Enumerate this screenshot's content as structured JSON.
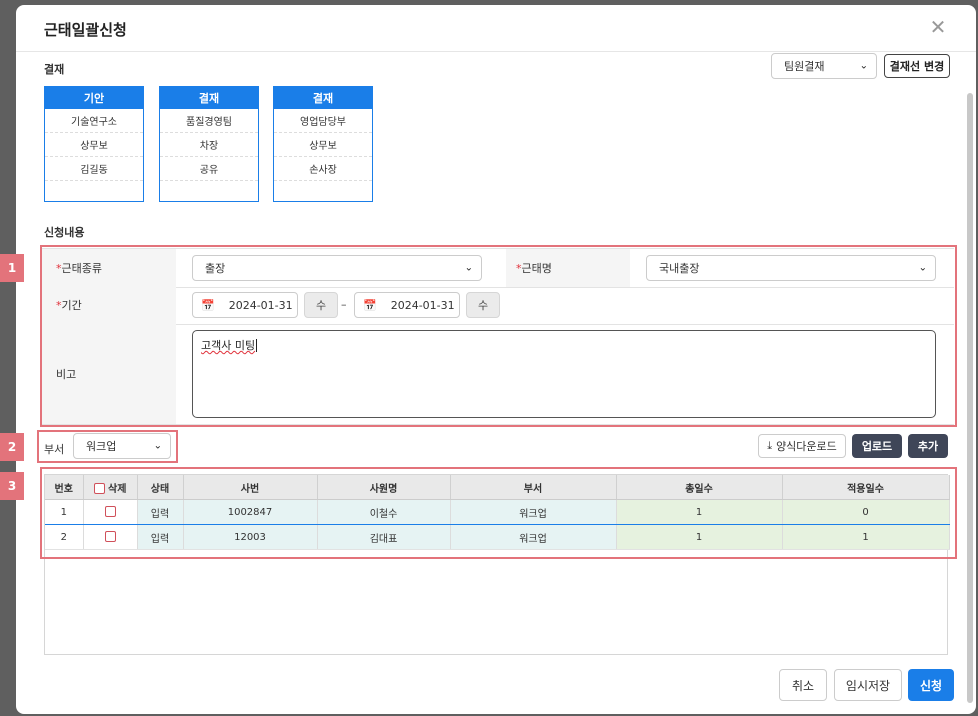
{
  "modal": {
    "title": "근태일괄신청",
    "close_symbol": "✕"
  },
  "approval": {
    "section_label": "결재",
    "line_select": {
      "value": "팀원결재"
    },
    "change_button": "결재선 변경",
    "boxes": [
      {
        "head": "기안",
        "rows": [
          "기술연구소",
          "상무보",
          "김길동"
        ]
      },
      {
        "head": "결재",
        "rows": [
          "품질경영팀",
          "차장",
          "공유"
        ]
      },
      {
        "head": "결재",
        "rows": [
          "영업담당부",
          "상무보",
          "손사장"
        ]
      }
    ]
  },
  "request": {
    "section_label": "신청내용",
    "type_label": "근태종류",
    "type_value": "출장",
    "name_label": "근태명",
    "name_value": "국내출장",
    "period_label": "기간",
    "start_date": "2024-01-31",
    "start_day": "수",
    "end_date": "2024-01-31",
    "end_day": "수",
    "tilde": "–",
    "remarks_label": "비고",
    "remarks_value": "고객사 미팅",
    "required_mark": "*"
  },
  "dept": {
    "label": "부서",
    "value": "워크업",
    "download_button": "양식다운로드",
    "upload_button": "업로드",
    "add_button": "추가"
  },
  "table": {
    "headers": [
      "번호",
      "삭제",
      "상태",
      "사번",
      "사원명",
      "부서",
      "총일수",
      "적용일수"
    ],
    "rows": [
      {
        "no": "1",
        "status": "입력",
        "emp_no": "1002847",
        "name": "이철수",
        "dept": "워크업",
        "total_days": "1",
        "applied_days": "0"
      },
      {
        "no": "2",
        "status": "입력",
        "emp_no": "12003",
        "name": "김대표",
        "dept": "워크업",
        "total_days": "1",
        "applied_days": "1"
      }
    ]
  },
  "footer": {
    "cancel": "취소",
    "temp_save": "임시저장",
    "submit": "신청"
  },
  "annotations": [
    "1",
    "2",
    "3"
  ],
  "colors": {
    "accent": "#1a7ee8",
    "annotation": "#e3737b",
    "dark_button": "#3f4658"
  }
}
